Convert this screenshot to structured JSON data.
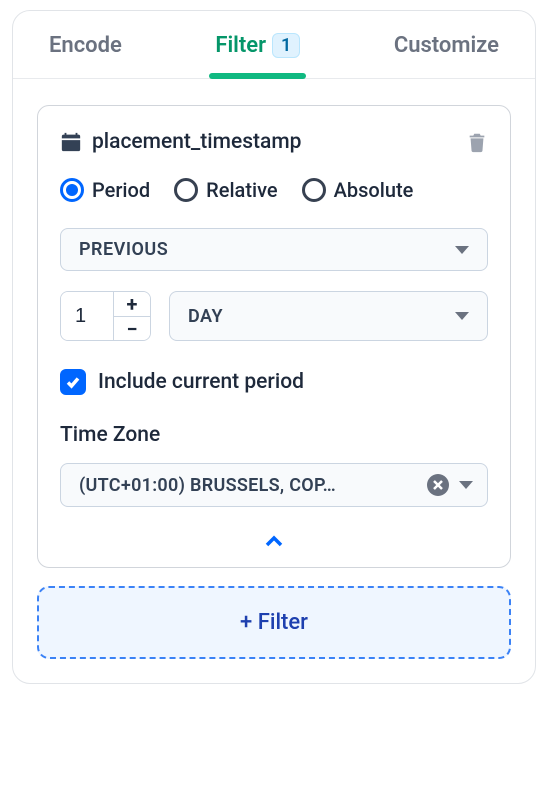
{
  "tabs": {
    "encode": "Encode",
    "filter": "Filter",
    "filter_badge": "1",
    "customize": "Customize"
  },
  "filter": {
    "field_name": "placement_timestamp",
    "modes": {
      "period": "Period",
      "relative": "Relative",
      "absolute": "Absolute"
    },
    "previous_select": "PREVIOUS",
    "quantity": "1",
    "unit_select": "DAY",
    "include_current": "Include current period",
    "timezone_label": "Time Zone",
    "timezone_value": "(UTC+01:00) BRUSSELS, COP…"
  },
  "add_filter_label": "+ Filter"
}
